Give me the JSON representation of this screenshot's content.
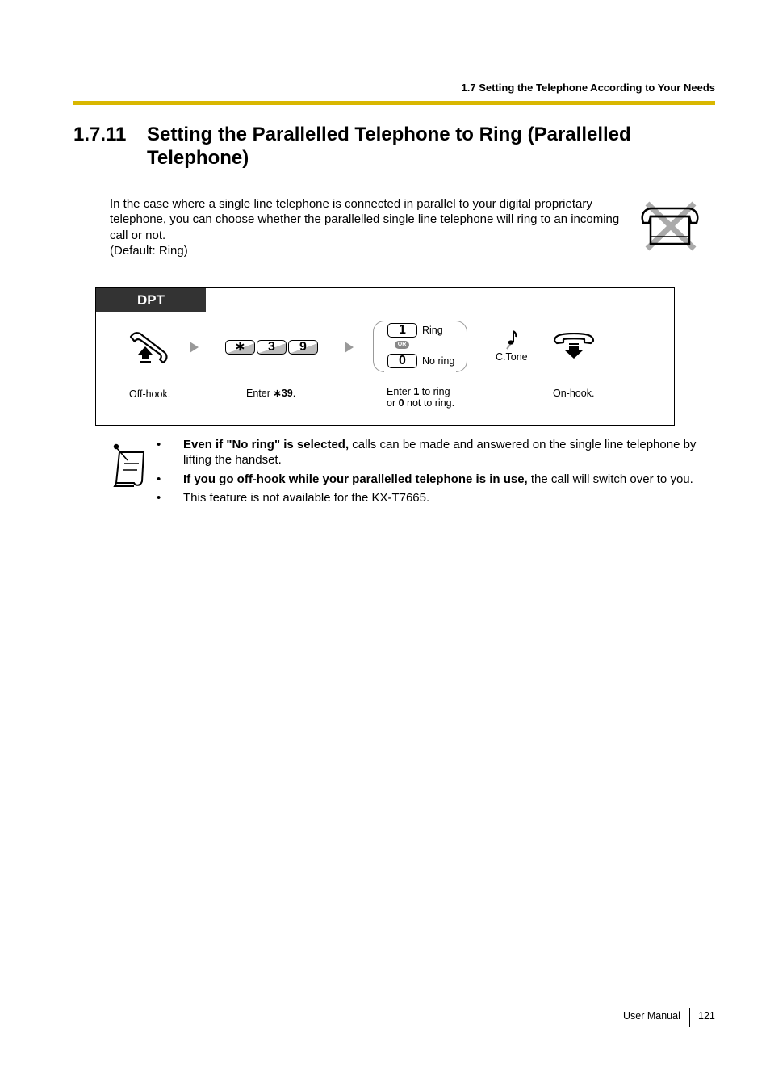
{
  "header": {
    "running_title": "1.7 Setting the Telephone According to Your Needs",
    "accent_color": "#d9b700"
  },
  "section": {
    "number": "1.7.11",
    "title_line1": "Setting the Parallelled Telephone to Ring (Parallelled",
    "title_line2": "Telephone)"
  },
  "intro": {
    "text": "In the case where a single line telephone is connected in parallel to your digital proprietary telephone, you can choose whether the parallelled single line telephone will ring to an incoming call or not.",
    "default": "(Default: Ring)",
    "icon": "crossed-out-telephone-icon"
  },
  "procedure": {
    "tag": "DPT",
    "steps": [
      {
        "icon": "off-hook-handset-icon",
        "caption": "Off-hook."
      },
      {
        "keys": [
          "∗",
          "3",
          "9"
        ],
        "caption_prefix": "Enter ",
        "caption_star": "∗",
        "caption_bold": "39",
        "caption_suffix": "."
      },
      {
        "options": [
          {
            "key": "1",
            "label": "Ring"
          },
          {
            "key": "0",
            "label": "No ring"
          }
        ],
        "or_label": "OR",
        "caption_l1_a": "Enter ",
        "caption_l1_b": "1",
        "caption_l1_c": " to ring",
        "caption_l2_a": "or ",
        "caption_l2_b": "0",
        "caption_l2_c": " not to ring."
      },
      {
        "icon": "confirmation-tone-icon",
        "label": "C.Tone"
      },
      {
        "icon": "on-hook-handset-icon",
        "caption": "On-hook."
      }
    ]
  },
  "notes": {
    "icon": "note-pad-icon",
    "items": [
      {
        "bold": "Even if \"No ring\" is selected,",
        "text": " calls can be made and answered on the single line telephone by lifting the handset."
      },
      {
        "bold": "If you go off-hook while your parallelled telephone is in use,",
        "text": " the call will switch over to you."
      },
      {
        "bold": "",
        "text": "This feature is not available for the KX-T7665."
      }
    ],
    "bullet": "•"
  },
  "footer": {
    "label": "User Manual",
    "page": "121"
  }
}
